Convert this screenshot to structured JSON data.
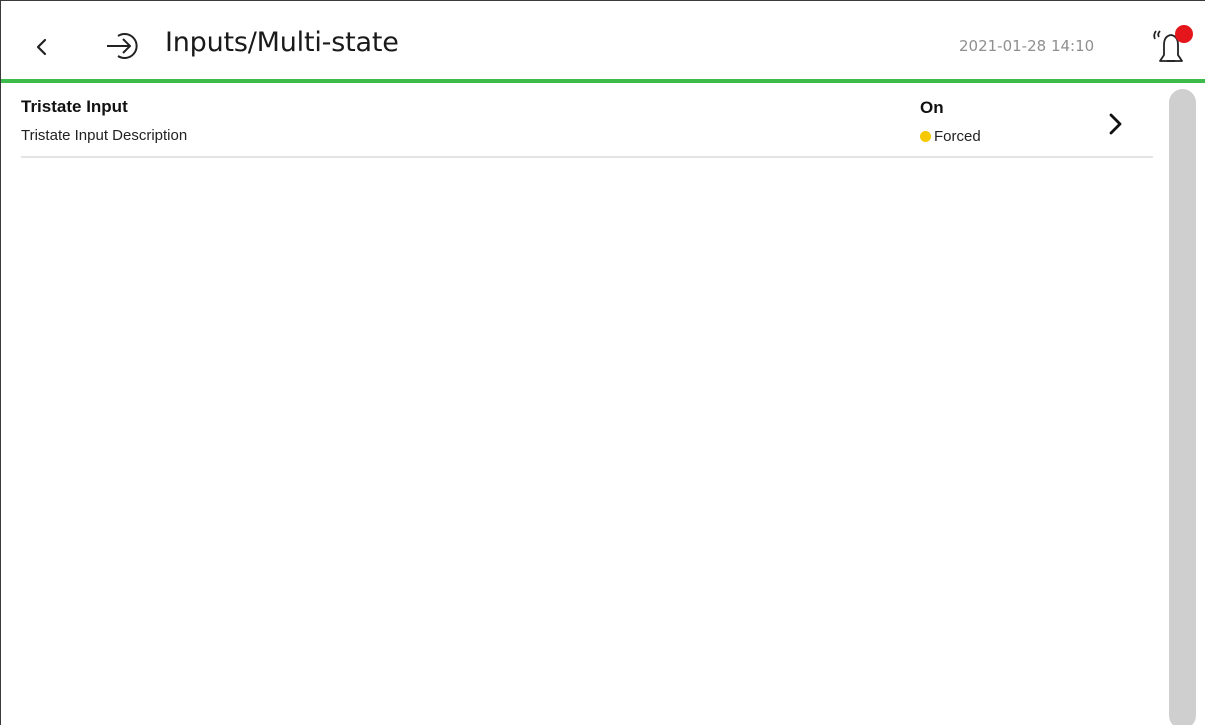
{
  "header": {
    "title": "Inputs/Multi-state",
    "datetime": "2021-01-28 14:10",
    "back_icon": "chevron-left-icon",
    "title_icon": "input-arrow-icon",
    "alarm_icon": "alarm-bell-icon",
    "accent_color": "#3dbb4a",
    "alarm_indicator_color": "#e4161b"
  },
  "list": {
    "items": [
      {
        "name": "Tristate Input",
        "description": "Tristate Input Description",
        "value": "On",
        "status": "Forced",
        "status_color": "#f5c800"
      }
    ]
  }
}
